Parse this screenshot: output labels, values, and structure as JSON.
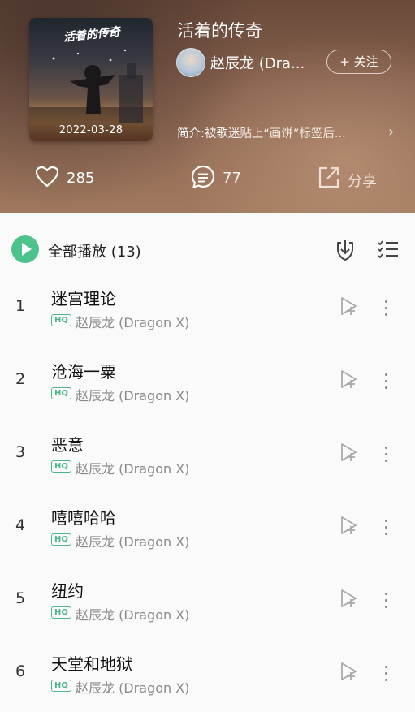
{
  "album": {
    "title": "活着的传奇",
    "cover_art_text": "活着的传奇",
    "date": "2022-03-28",
    "artist": "赵辰龙 (Dra...",
    "follow_label": "+ 关注",
    "intro": "简介:被歌迷贴上“画饼”标签后...",
    "intro_arrow": "›"
  },
  "stats": {
    "likes": "285",
    "comments": "77",
    "share_label": "分享"
  },
  "toolbar": {
    "play_all_label": "全部播放 (13)"
  },
  "songs": [
    {
      "index": "1",
      "title": "迷宫理论",
      "badge": "HQ",
      "artist": "赵辰龙 (Dragon X)"
    },
    {
      "index": "2",
      "title": "沧海一粟",
      "badge": "HQ",
      "artist": "赵辰龙 (Dragon X)"
    },
    {
      "index": "3",
      "title": "恶意",
      "badge": "HQ",
      "artist": "赵辰龙 (Dragon X)"
    },
    {
      "index": "4",
      "title": "嘻嘻哈哈",
      "badge": "HQ",
      "artist": "赵辰龙 (Dragon X)"
    },
    {
      "index": "5",
      "title": "纽约",
      "badge": "HQ",
      "artist": "赵辰龙 (Dragon X)"
    },
    {
      "index": "6",
      "title": "天堂和地狱",
      "badge": "HQ",
      "artist": "赵辰龙 (Dragon X)"
    }
  ],
  "colors": {
    "accent_green": "#4cc38a",
    "header_brown": "#8a6450"
  },
  "icons": {
    "like": "heart-icon",
    "comment": "comment-icon",
    "share": "share-icon",
    "play": "play-icon",
    "download": "download-icon",
    "multi_select": "multi-select-icon",
    "add_to_playlist": "add-to-playlist-icon",
    "more": "more-icon"
  }
}
